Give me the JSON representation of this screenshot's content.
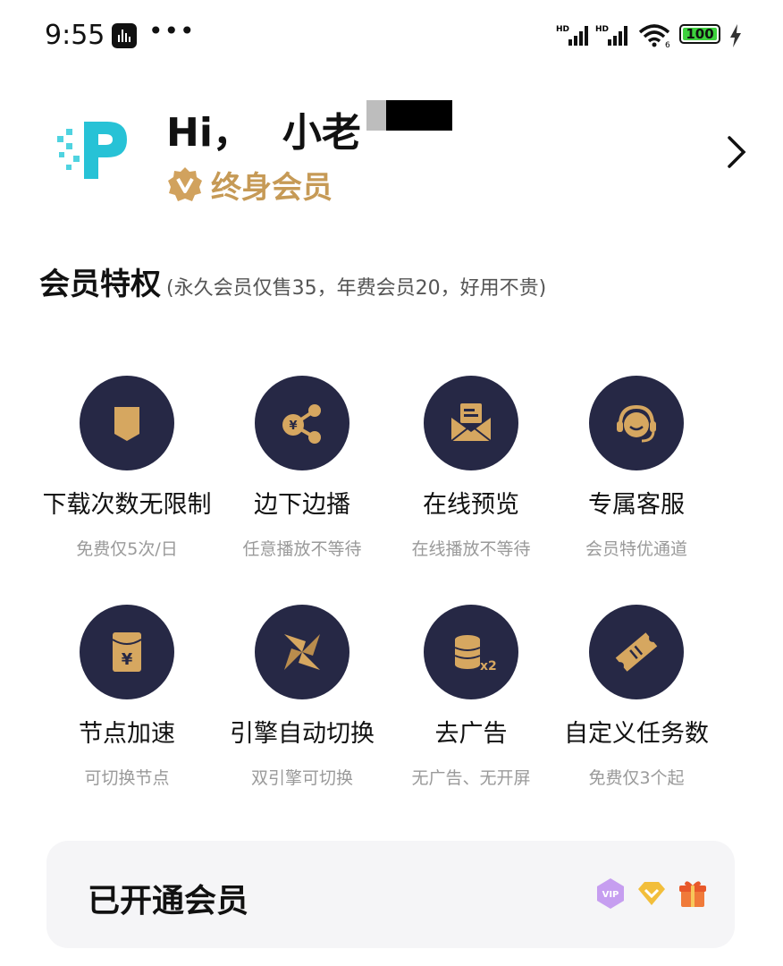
{
  "status_bar": {
    "time": "9:55",
    "signal_1_label": "HD",
    "signal_2_label": "HD",
    "wifi_sub": "6",
    "battery_level": "100"
  },
  "profile": {
    "greeting": "Hi，",
    "name_visible": "小老",
    "membership": "终身会员"
  },
  "privileges": {
    "title": "会员特权",
    "subtitle": "(永久会员仅售35，年费会员20，好用不贵)",
    "items": [
      {
        "title": "下载次数无限制",
        "sub": "免费仅5次/日",
        "icon": "pocket-icon"
      },
      {
        "title": "边下边播",
        "sub": "任意播放不等待",
        "icon": "share-yuan-icon"
      },
      {
        "title": "在线预览",
        "sub": "在线播放不等待",
        "icon": "mail-preview-icon"
      },
      {
        "title": "专属客服",
        "sub": "会员特优通道",
        "icon": "headset-icon"
      },
      {
        "title": "节点加速",
        "sub": "可切换节点",
        "icon": "yuan-envelope-icon"
      },
      {
        "title": "引擎自动切换",
        "sub": "双引擎可切换",
        "icon": "pinwheel-icon"
      },
      {
        "title": "去广告",
        "sub": "无广告、无开屏",
        "icon": "coins-x2-icon",
        "icon_text": "x2"
      },
      {
        "title": "自定义任务数",
        "sub": "免费仅3个起",
        "icon": "ticket-icon"
      }
    ]
  },
  "vip_card": {
    "title": "已开通会员",
    "badge_vip_text": "VIP"
  },
  "colors": {
    "icon_circle": "#262845",
    "gold": "#c69a56",
    "muted_text": "#9a9a9a"
  }
}
